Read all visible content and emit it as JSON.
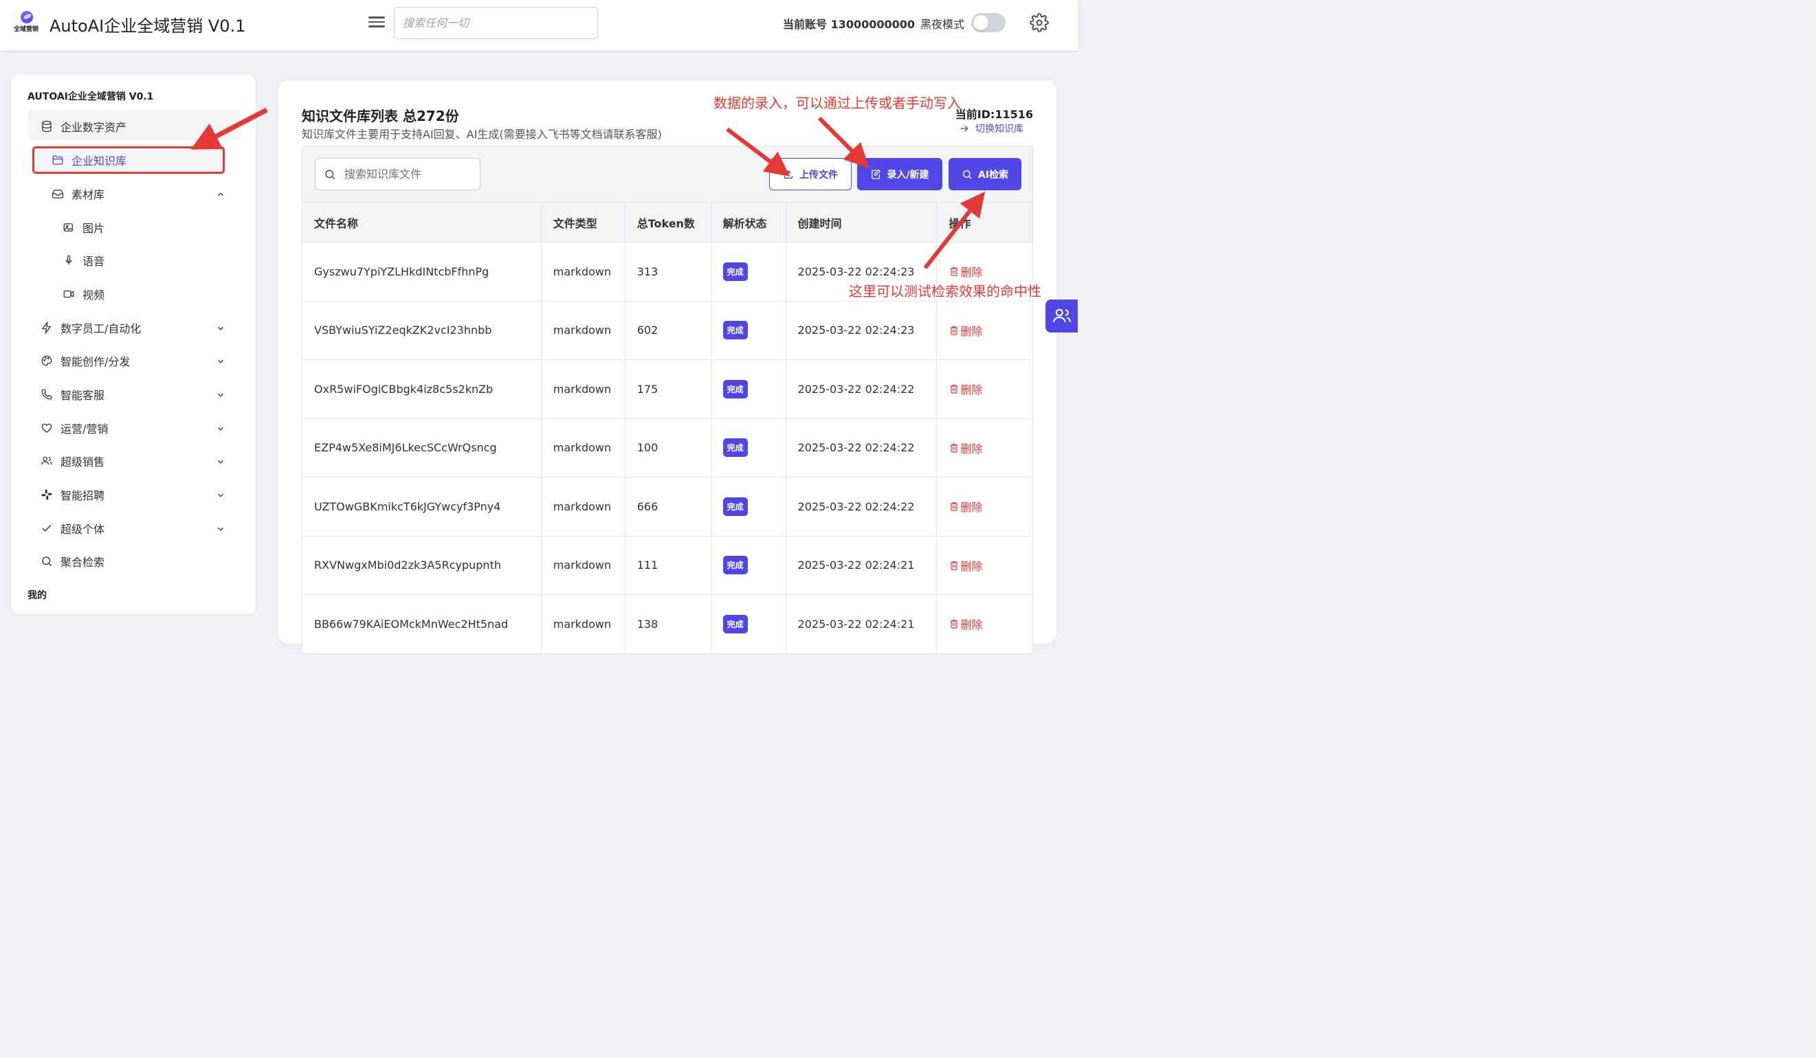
{
  "header": {
    "logo_text": "全域营销",
    "app_title": "AutoAI企业全域营销 V0.1",
    "search_placeholder": "搜索任何一切",
    "account": "当前账号 13000000000",
    "night_mode_label": "黑夜模式",
    "night_mode_on": false
  },
  "sidebar": {
    "title": "AUTOAI企业全域营销 V0.1",
    "group_label": "企业数字资产",
    "knowledge_base": "企业知识库",
    "materials": "素材库",
    "images": "图片",
    "voice": "语音",
    "video": "视频",
    "digital_staff": "数字员工/自动化",
    "smart_creation": "智能创作/分发",
    "smart_cs": "智能客服",
    "ops_marketing": "运营/营销",
    "super_sales": "超级销售",
    "smart_recruit": "智能招聘",
    "super_individual": "超级个体",
    "agg_search": "聚合检索",
    "mine": "我的"
  },
  "main": {
    "title": "知识文件库列表 总272份",
    "subtitle": "知识库文件主要用于支持AI回复、AI生成(需要接入飞书等文档请联系客服)",
    "current_id": "当前ID:11516",
    "switch_kb": "切换知识库",
    "search_placeholder": "搜索知识库文件",
    "upload_label": "上传文件",
    "new_label": "录入/新建",
    "ai_search_label": "AI检索"
  },
  "table": {
    "headers": [
      "文件名称",
      "文件类型",
      "总Token数",
      "解析状态",
      "创建时间",
      "操作"
    ],
    "rows": [
      {
        "name": "Gyszwu7YpiYZLHkdINtcbFfhnPg",
        "type": "markdown",
        "tokens": "313",
        "status": "完成",
        "time": "2025-03-22 02:24:23",
        "action": "删除"
      },
      {
        "name": "VSBYwiuSYiZ2eqkZK2vcI23hnbb",
        "type": "markdown",
        "tokens": "602",
        "status": "完成",
        "time": "2025-03-22 02:24:23",
        "action": "删除"
      },
      {
        "name": "OxR5wiFOgiCBbgk4iz8c5s2knZb",
        "type": "markdown",
        "tokens": "175",
        "status": "完成",
        "time": "2025-03-22 02:24:22",
        "action": "删除"
      },
      {
        "name": "EZP4w5Xe8iMJ6LkecSCcWrQsncg",
        "type": "markdown",
        "tokens": "100",
        "status": "完成",
        "time": "2025-03-22 02:24:22",
        "action": "删除"
      },
      {
        "name": "UZTOwGBKmikcT6kJGYwcyf3Pny4",
        "type": "markdown",
        "tokens": "666",
        "status": "完成",
        "time": "2025-03-22 02:24:22",
        "action": "删除"
      },
      {
        "name": "RXVNwgxMbi0d2zk3A5Rcypupnth",
        "type": "markdown",
        "tokens": "111",
        "status": "完成",
        "time": "2025-03-22 02:24:21",
        "action": "删除"
      },
      {
        "name": "BB66w79KAiEOMckMnWec2Ht5nad",
        "type": "markdown",
        "tokens": "138",
        "status": "完成",
        "time": "2025-03-22 02:24:21",
        "action": "删除"
      }
    ]
  },
  "annotations": {
    "top": "数据的录入，可以通过上传或者手动写入",
    "bottom": "这里可以测试检索效果的命中性"
  },
  "colors": {
    "accent": "#4f46e5",
    "danger": "#e53935",
    "background": "#eef0f5"
  }
}
